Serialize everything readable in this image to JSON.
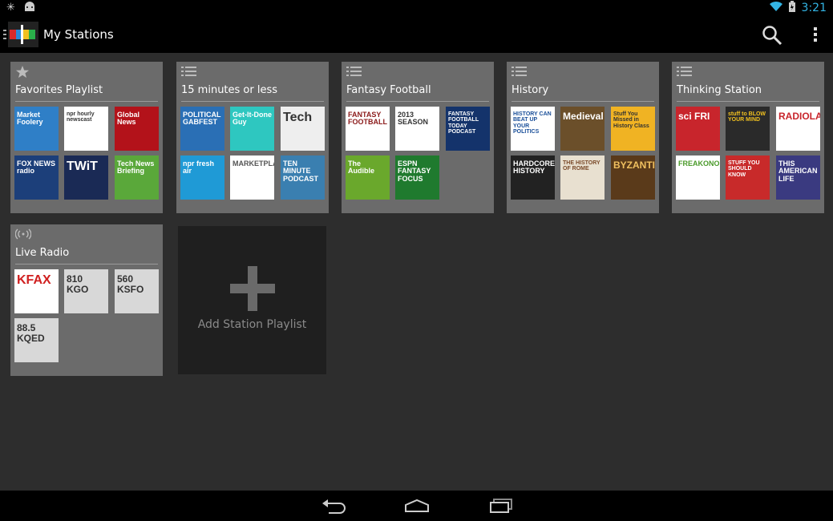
{
  "status": {
    "time": "3:21"
  },
  "app": {
    "title": "My Stations"
  },
  "icons": {
    "search": "search-icon",
    "overflow": "overflow-menu-icon",
    "back": "back-icon",
    "home": "home-icon",
    "recents": "recent-apps-icon"
  },
  "colors": {
    "accent": "#33b5e5",
    "card": "#6b6b6b",
    "background": "#2d2d2d"
  },
  "playlists": [
    {
      "title": "Favorites Playlist",
      "type_icon": "star-icon",
      "tiles": [
        {
          "text": "Market Foolery",
          "bg": "#2f7fc7",
          "fg": "#ffffff"
        },
        {
          "text": "npr hourly newscast",
          "bg": "#ffffff",
          "fg": "#333333"
        },
        {
          "text": "Global News",
          "bg": "#b3121a",
          "fg": "#ffffff"
        },
        {
          "text": "FOX NEWS radio",
          "bg": "#1c3f7a",
          "fg": "#ffffff"
        },
        {
          "text": "TWiT",
          "bg": "#1a2a55",
          "fg": "#ffffff"
        },
        {
          "text": "Tech News Briefing",
          "bg": "#5aa83a",
          "fg": "#ffffff"
        }
      ]
    },
    {
      "title": "15 minutes or less",
      "type_icon": "list-icon",
      "tiles": [
        {
          "text": "POLITICAL GABFEST",
          "bg": "#2a6fb5",
          "fg": "#ffffff"
        },
        {
          "text": "Get-It-Done Guy",
          "bg": "#2ec7c0",
          "fg": "#ffffff"
        },
        {
          "text": "Tech",
          "bg": "#eeeeee",
          "fg": "#333333"
        },
        {
          "text": "npr fresh air",
          "bg": "#1f9ad6",
          "fg": "#ffffff"
        },
        {
          "text": "MARKETPLACE",
          "bg": "#ffffff",
          "fg": "#555555"
        },
        {
          "text": "TEN MINUTE PODCAST",
          "bg": "#3a7fb0",
          "fg": "#ffffff"
        }
      ]
    },
    {
      "title": "Fantasy Football",
      "type_icon": "list-icon",
      "tiles": [
        {
          "text": "FANTASY FOOTBALL",
          "bg": "#ffffff",
          "fg": "#8b1a1a"
        },
        {
          "text": "2013 SEASON",
          "bg": "#ffffff",
          "fg": "#333333"
        },
        {
          "text": "FANTASY FOOTBALL TODAY PODCAST",
          "bg": "#14336b",
          "fg": "#ffffff"
        },
        {
          "text": "The Audible",
          "bg": "#6aa82c",
          "fg": "#ffffff"
        },
        {
          "text": "ESPN FANTASY FOCUS",
          "bg": "#1f7a2e",
          "fg": "#ffffff"
        }
      ]
    },
    {
      "title": "History",
      "type_icon": "list-icon",
      "tiles": [
        {
          "text": "HISTORY CAN BEAT UP YOUR POLITICS",
          "bg": "#ffffff",
          "fg": "#1a4f99"
        },
        {
          "text": "Medieval",
          "bg": "#6b4f2a",
          "fg": "#ffffff"
        },
        {
          "text": "Stuff You Missed in History Class",
          "bg": "#f0b323",
          "fg": "#333333"
        },
        {
          "text": "HARDCORE HISTORY",
          "bg": "#222222",
          "fg": "#ffffff"
        },
        {
          "text": "THE HISTORY OF ROME",
          "bg": "#e8e0d0",
          "fg": "#7a4a2a"
        },
        {
          "text": "BYZANTIUM",
          "bg": "#5a3a1a",
          "fg": "#f0c060"
        }
      ]
    },
    {
      "title": "Thinking Station",
      "type_icon": "list-icon",
      "tiles": [
        {
          "text": "sci FRI",
          "bg": "#c8252c",
          "fg": "#ffffff"
        },
        {
          "text": "stuff to BLOW YOUR MIND",
          "bg": "#2a2a2a",
          "fg": "#f0c020"
        },
        {
          "text": "RADIOLAB",
          "bg": "#ffffff",
          "fg": "#c8252c"
        },
        {
          "text": "FREAKONOMICS",
          "bg": "#ffffff",
          "fg": "#4a9a2a"
        },
        {
          "text": "STUFF YOU SHOULD KNOW",
          "bg": "#c82a2a",
          "fg": "#ffffff"
        },
        {
          "text": "THIS AMERICAN LIFE",
          "bg": "#3a3a80",
          "fg": "#ffffff"
        }
      ]
    },
    {
      "title": "Live Radio",
      "type_icon": "radio-wave-icon",
      "tiles": [
        {
          "text": "KFAX",
          "bg": "#ffffff",
          "fg": "#d02020"
        },
        {
          "text": "810 KGO",
          "bg": "#d8d8d8",
          "fg": "#333333"
        },
        {
          "text": "560 KSFO",
          "bg": "#d8d8d8",
          "fg": "#333333"
        },
        {
          "text": "88.5 KQED",
          "bg": "#d8d8d8",
          "fg": "#333333"
        }
      ]
    }
  ],
  "add_playlist": {
    "label": "Add Station Playlist"
  }
}
